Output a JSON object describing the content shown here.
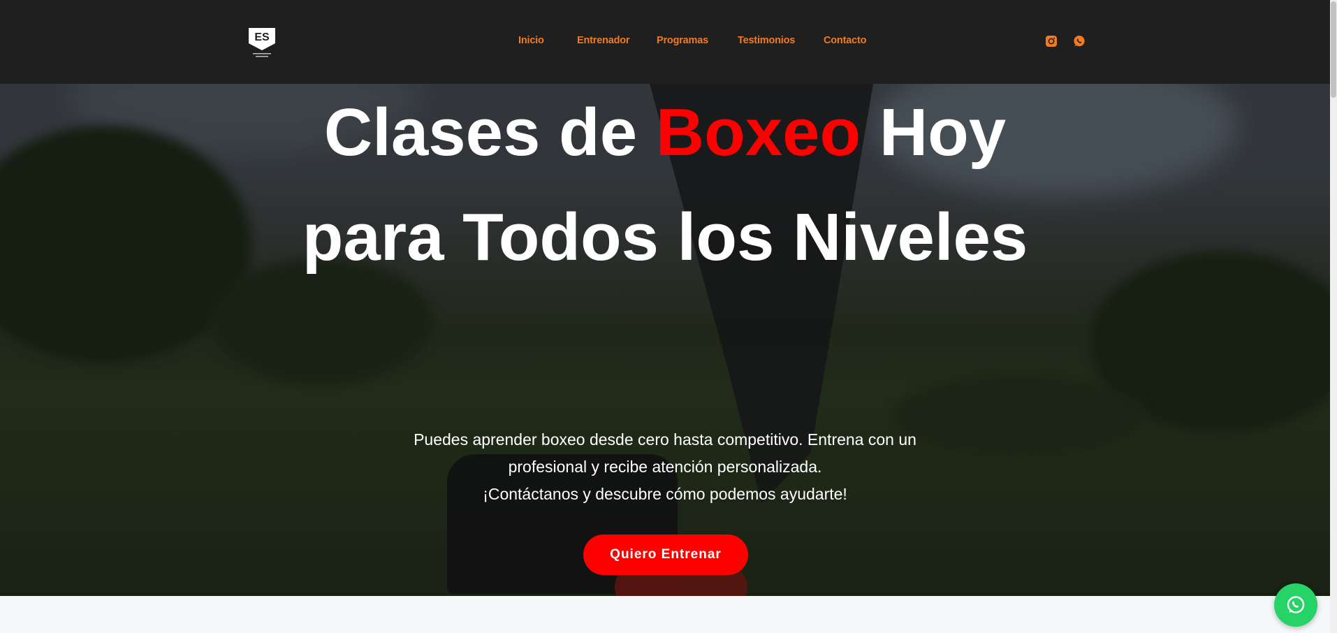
{
  "header": {
    "logo_name": "logo-icon",
    "nav": [
      {
        "label": "Inicio"
      },
      {
        "label": "Entrenador"
      },
      {
        "label": "Programas"
      },
      {
        "label": "Testimonios"
      },
      {
        "label": "Contacto"
      }
    ],
    "social": [
      "instagram-icon",
      "whatsapp-icon"
    ],
    "accent_color": "#f47a1f"
  },
  "hero": {
    "headline_part1": "Clases de ",
    "headline_accent": "Boxeo",
    "headline_part2": " Hoy para Todos los Niveles",
    "headline_accent_color": "#ff0000",
    "subtext_line1": "Puedes aprender boxeo desde cero hasta competitivo. Entrena con un profesional y recibe atención personalizada.",
    "subtext_line2": "¡Contáctanos y descubre cómo podemos ayudarte!",
    "cta_label": "Quiero Entrenar",
    "cta_color": "#ff0000"
  },
  "floating": {
    "whatsapp_color": "#25d366"
  }
}
